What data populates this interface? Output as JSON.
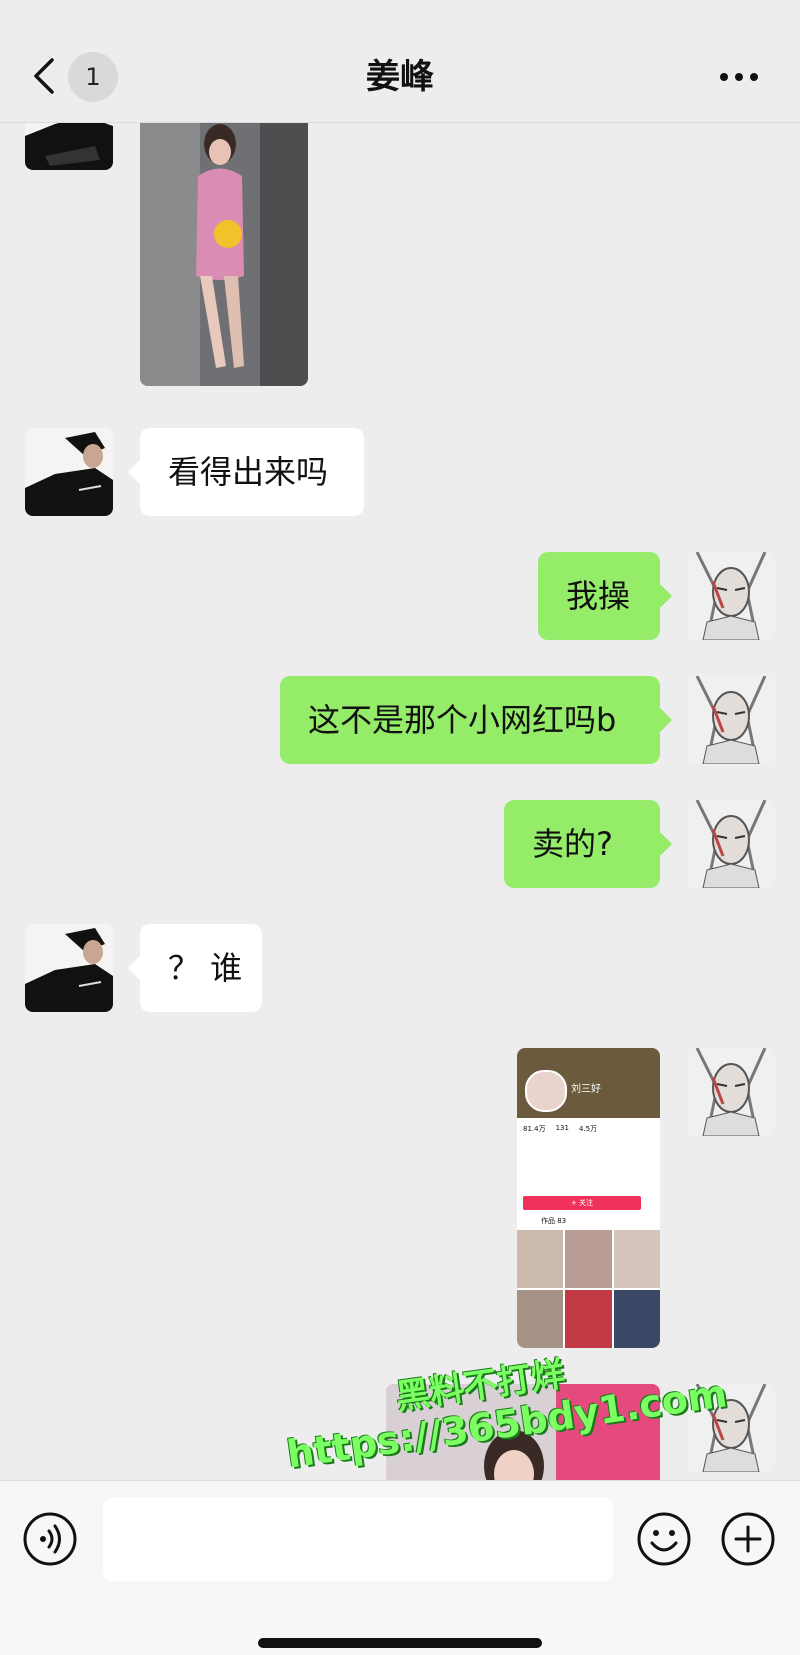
{
  "header": {
    "unread_count": "1",
    "title": "姜峰"
  },
  "messages": [
    {
      "from": "other",
      "type": "image",
      "description_icon": "photo"
    },
    {
      "from": "other",
      "type": "text",
      "text": "看得出来吗"
    },
    {
      "from": "me",
      "type": "text",
      "text": "我操"
    },
    {
      "from": "me",
      "type": "text",
      "text": "这不是那个小网红吗b"
    },
    {
      "from": "me",
      "type": "text",
      "text": "卖的?"
    },
    {
      "from": "other",
      "type": "text",
      "text": "？ 谁"
    },
    {
      "from": "me",
      "type": "image",
      "thumb": {
        "name": "刘三好",
        "stats": [
          "81.4万",
          "131",
          "4.5万"
        ],
        "follow_button": "+ 关注",
        "tab_works": "作品 83"
      }
    },
    {
      "from": "me",
      "type": "image"
    }
  ],
  "watermark": {
    "line1": "黑料不打烊",
    "line2": "https://365bdy1.com"
  },
  "colors": {
    "out_bubble": "#95ec69",
    "in_bubble": "#ffffff",
    "background": "#ededed"
  }
}
